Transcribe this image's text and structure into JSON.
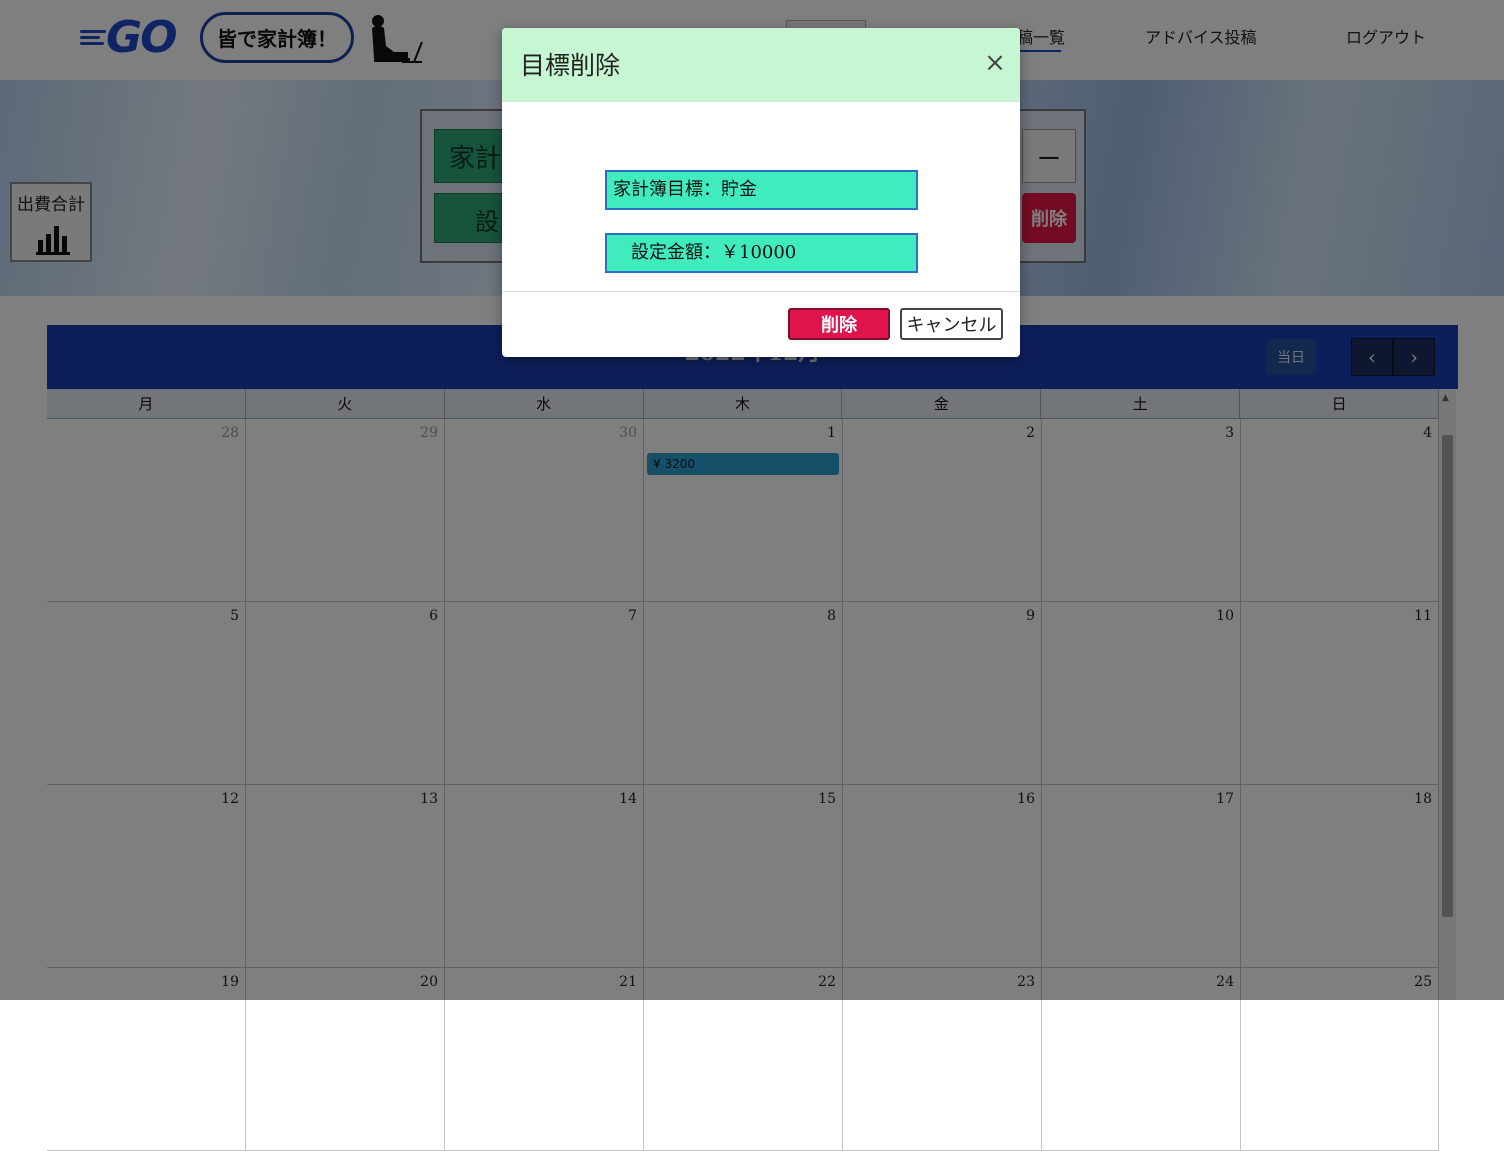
{
  "header": {
    "logo_text": "GO",
    "catchphrase": "皆で家計簿！",
    "nav": [
      {
        "label": "稿一覧"
      },
      {
        "label": "アドバイス投稿"
      },
      {
        "label": "ログアウト"
      }
    ]
  },
  "hero": {
    "stat_button_label": "出費合計",
    "panel": {
      "btn1_label": "家計",
      "btn2_label": "設",
      "tab_label": "ー",
      "delete_label": "削除"
    }
  },
  "calendar": {
    "title": "2022年12月",
    "today_label": "当日",
    "prev_icon": "‹",
    "next_icon": "›",
    "weekdays": [
      "月",
      "火",
      "水",
      "木",
      "金",
      "土",
      "日"
    ],
    "weeks": [
      [
        "28",
        "29",
        "30",
        "1",
        "2",
        "3",
        "4"
      ],
      [
        "5",
        "6",
        "7",
        "8",
        "9",
        "10",
        "11"
      ],
      [
        "12",
        "13",
        "14",
        "15",
        "16",
        "17",
        "18"
      ],
      [
        "19",
        "20",
        "21",
        "22",
        "23",
        "24",
        "25"
      ]
    ],
    "event": {
      "label": "¥ 3200"
    }
  },
  "modal": {
    "title": "目標削除",
    "close_symbol": "×",
    "goal_text": "家計簿目標：貯金",
    "amount_text": "設定金額：￥10000",
    "delete_label": "削除",
    "cancel_label": "キャンセル"
  },
  "colors": {
    "modal_header": "#c6f7d2",
    "info_box": "#40ecbe",
    "delete_button": "#e0144d",
    "calendar_bar": "#1a3fb7",
    "event": "#2b9fd0"
  }
}
